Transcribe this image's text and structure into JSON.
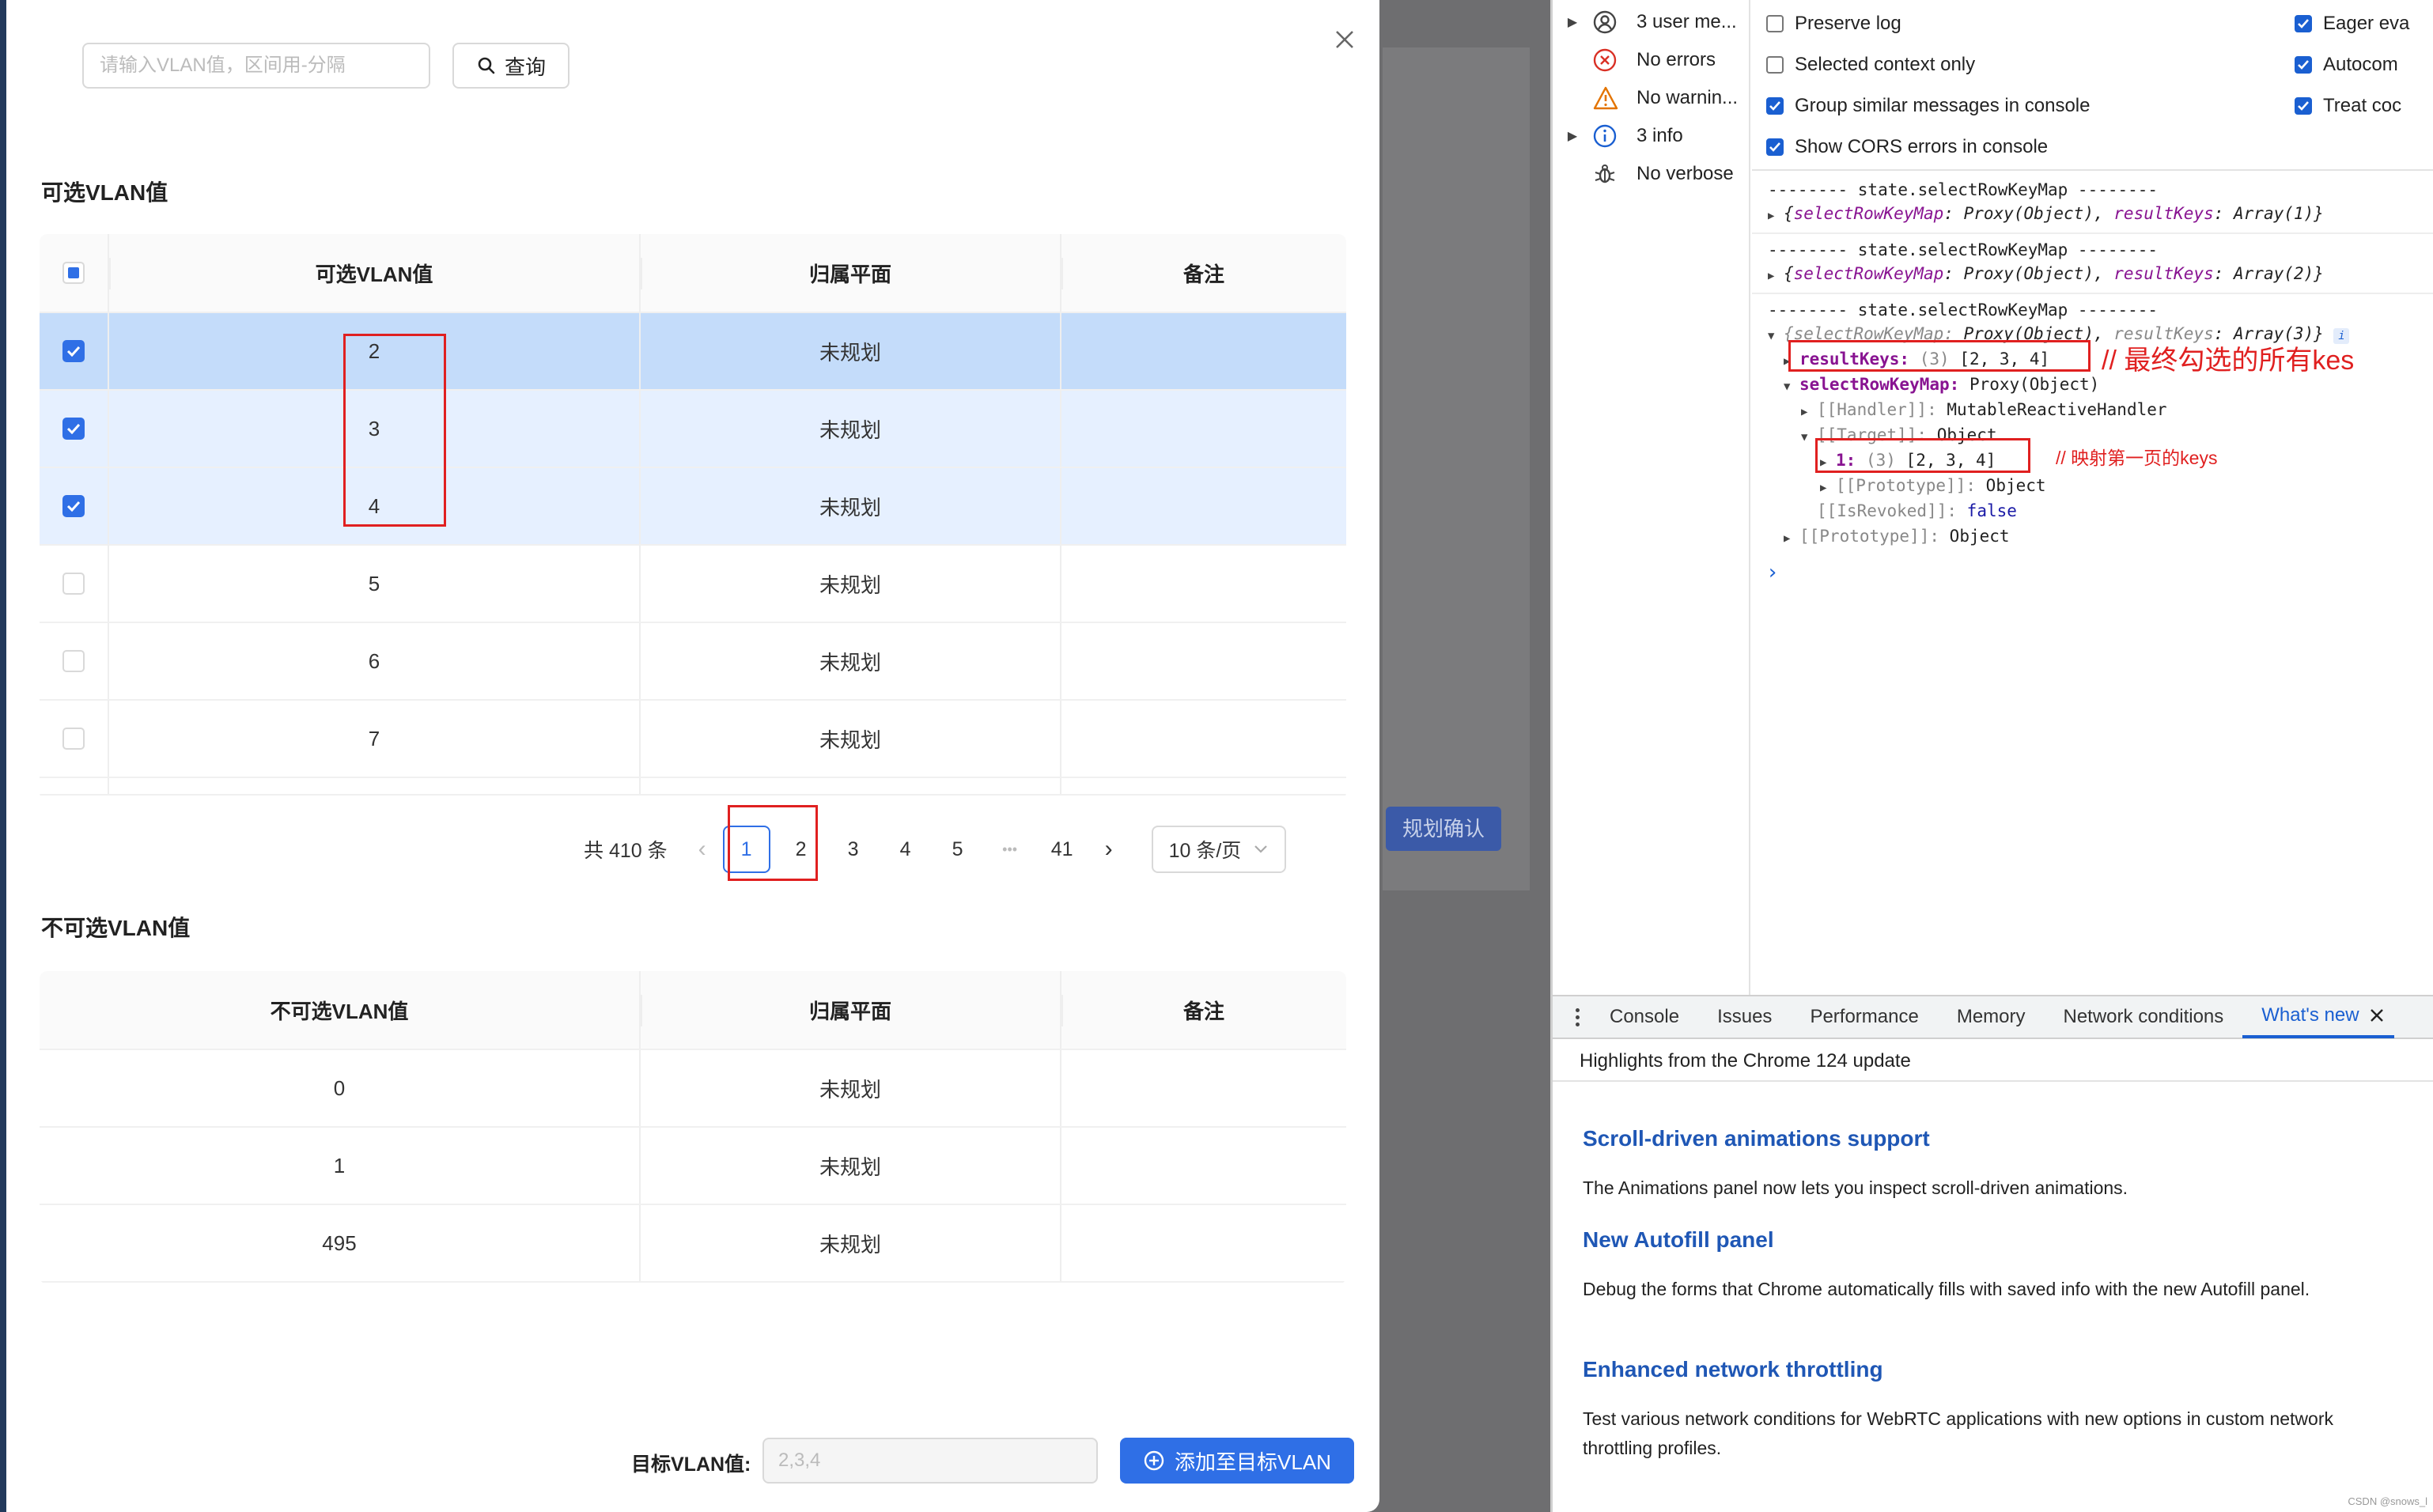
{
  "modal": {
    "search_placeholder": "请输入VLAN值，区间用-分隔",
    "query_label": "查询",
    "selectable": {
      "title": "可选VLAN值",
      "headers": [
        "可选VLAN值",
        "归属平面",
        "备注"
      ],
      "rows": [
        {
          "value": "2",
          "plane": "未规划",
          "checked": true
        },
        {
          "value": "3",
          "plane": "未规划",
          "checked": true
        },
        {
          "value": "4",
          "plane": "未规划",
          "checked": true
        },
        {
          "value": "5",
          "plane": "未规划",
          "checked": false
        },
        {
          "value": "6",
          "plane": "未规划",
          "checked": false
        },
        {
          "value": "7",
          "plane": "未规划",
          "checked": false
        }
      ]
    },
    "pagination": {
      "total": "共 410 条",
      "pages": [
        "1",
        "2",
        "3",
        "4",
        "5"
      ],
      "ellipsis": "•••",
      "last": "41",
      "page_size": "10 条/页",
      "prev": "‹",
      "next": "›"
    },
    "unselectable": {
      "title": "不可选VLAN值",
      "headers": [
        "不可选VLAN值",
        "归属平面",
        "备注"
      ],
      "rows": [
        {
          "value": "0",
          "plane": "未规划"
        },
        {
          "value": "1",
          "plane": "未规划"
        },
        {
          "value": "495",
          "plane": "未规划"
        }
      ]
    },
    "target_label": "目标VLAN值:",
    "target_value": "2,3,4",
    "add_button": "添加至目标VLAN"
  },
  "background": {
    "confirm_button": "规划确认"
  },
  "devtools": {
    "filters": [
      {
        "label": "3 user me...",
        "icon": "user-icon",
        "expandable": true
      },
      {
        "label": "No errors",
        "icon": "error-icon",
        "expandable": false
      },
      {
        "label": "No warnin...",
        "icon": "warning-icon",
        "expandable": false
      },
      {
        "label": "3 info",
        "icon": "info-icon",
        "expandable": true
      },
      {
        "label": "No verbose",
        "icon": "bug-icon",
        "expandable": false
      }
    ],
    "settings_left": [
      {
        "label": "Preserve log",
        "checked": false
      },
      {
        "label": "Selected context only",
        "checked": false
      },
      {
        "label": "Group similar messages in console",
        "checked": true
      },
      {
        "label": "Show CORS errors in console",
        "checked": true
      }
    ],
    "settings_right": [
      {
        "label": "Eager eva",
        "checked": true
      },
      {
        "label": "Autocom",
        "checked": true
      },
      {
        "label": "Treat coc",
        "checked": true
      }
    ],
    "console": {
      "header": "-------- state.selectRowKeyMap --------",
      "obj_open": "{",
      "obj_close": "}",
      "k_map": "selectRowKeyMap",
      "v_proxy": "Proxy(Object)",
      "k_keys": "resultKeys",
      "v_arr1": "Array(1)",
      "v_arr2": "Array(2)",
      "v_arr3": "Array(3)",
      "colon": ": ",
      "comma": ", ",
      "result_key": "resultKeys:",
      "arr_len": "(3)",
      "arr_val": "[2, 3, 4]",
      "map_key": "selectRowKeyMap:",
      "map_val": "Proxy(Object)",
      "handler_key": "[[Handler]]:",
      "handler_val": "MutableReactiveHandler",
      "target_key": "[[Target]]:",
      "target_val": "Object",
      "one_key": "1:",
      "proto_key": "[[Prototype]]:",
      "proto_val": "Object",
      "revoked_key": "[[IsRevoked]]:",
      "revoked_val": "false",
      "prompt": "›",
      "info_badge": "i"
    },
    "annotations": {
      "final_keys": "// 最终勾选的所有kes",
      "page_keys": "// 映射第一页的keys"
    },
    "tabs": [
      "Console",
      "Issues",
      "Performance",
      "Memory",
      "Network conditions",
      "What's new"
    ],
    "whats_new": {
      "subtitle": "Highlights from the Chrome 124 update",
      "items": [
        {
          "title": "Scroll-driven animations support",
          "body": "The Animations panel now lets you inspect scroll-driven animations."
        },
        {
          "title": "New Autofill panel",
          "body": "Debug the forms that Chrome automatically fills with saved info with the new Autofill panel."
        },
        {
          "title": "Enhanced network throttling",
          "body": "Test various network conditions for WebRTC applications with new options in custom network throttling profiles."
        }
      ]
    },
    "watermark": "CSDN @snows_l"
  }
}
